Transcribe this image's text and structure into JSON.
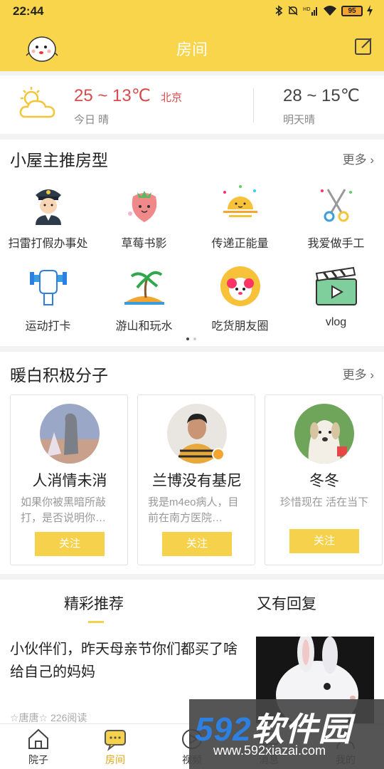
{
  "status_bar": {
    "time": "22:44",
    "battery": "95",
    "icons": [
      "bluetooth-icon",
      "mute-icon",
      "hd-signal-icon",
      "wifi-icon",
      "battery-icon",
      "charging-icon"
    ]
  },
  "header": {
    "title": "房间",
    "left_icon": "mascot-avatar",
    "right_icon": "edit-icon"
  },
  "weather": {
    "today_temp": "25 ~ 13℃",
    "city": "北京",
    "today_label": "今日 晴",
    "tomorrow_temp": "28 ~ 15℃",
    "tomorrow_label": "明天晴"
  },
  "section_rooms": {
    "title": "小屋主推房型",
    "more": "更多",
    "items": [
      {
        "label": "扫雷打假办事处",
        "icon": "police-officer-icon"
      },
      {
        "label": "草莓书影",
        "icon": "strawberry-icon"
      },
      {
        "label": "传递正能量",
        "icon": "sunrise-icon"
      },
      {
        "label": "我爱做手工",
        "icon": "scissors-icon"
      },
      {
        "label": "运动打卡",
        "icon": "fist-dumbbell-icon"
      },
      {
        "label": "游山和玩水",
        "icon": "palm-island-icon"
      },
      {
        "label": "吃货朋友圈",
        "icon": "foodie-avatar-icon"
      },
      {
        "label": "vlog",
        "icon": "clapperboard-icon"
      }
    ],
    "page_total": 2,
    "page_current": 1
  },
  "section_people": {
    "title": "暖白积极分子",
    "more": "更多",
    "cards": [
      {
        "name": "人消情未消",
        "desc": "如果你被黑暗所敲打，是否说明你…",
        "button": "关注"
      },
      {
        "name": "兰博没有基尼",
        "desc": "我是m4eo病人，目前在南方医院…",
        "button": "关注"
      },
      {
        "name": "冬冬",
        "desc": "珍惜现在 活在当下",
        "button": "关注"
      }
    ]
  },
  "feed": {
    "tabs": [
      "精彩推荐",
      "又有回复"
    ],
    "active_tab": "精彩推荐",
    "article": {
      "title": "小伙伴们，昨天母亲节你们都买了啥给自己的妈妈",
      "meta": "☆唐唐☆   226阅读"
    }
  },
  "bottom_nav": {
    "items": [
      "院子",
      "房间",
      "视频",
      "消息",
      "我的"
    ],
    "active": "房间"
  },
  "watermark": {
    "brand_number": "592",
    "brand_text": "软件园",
    "url": "www.592xiazai.com"
  },
  "colors": {
    "brand_yellow": "#f8d54a",
    "button_yellow": "#f6d14c",
    "temp_red": "#d94b4b",
    "active_nav": "#e0a412"
  }
}
